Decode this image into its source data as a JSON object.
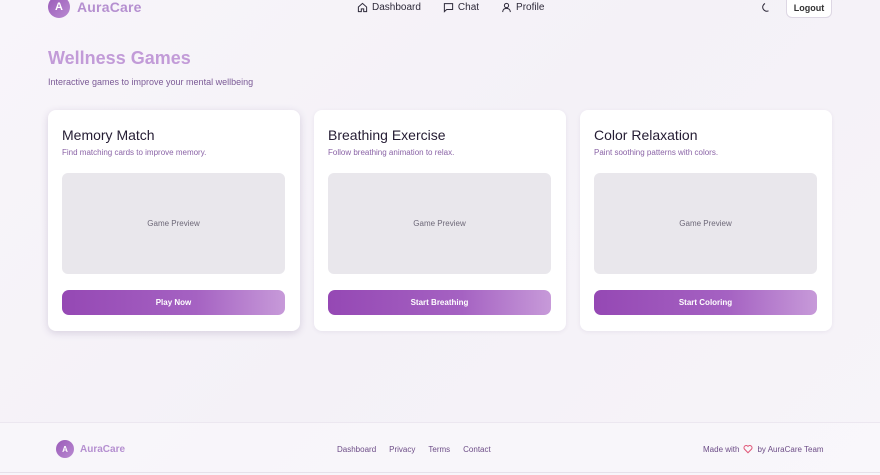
{
  "brand": {
    "logo_letter": "A",
    "name": "AuraCare"
  },
  "nav": {
    "items": [
      {
        "label": "Dashboard",
        "icon": "home-icon"
      },
      {
        "label": "Chat",
        "icon": "chat-icon"
      },
      {
        "label": "Profile",
        "icon": "user-icon"
      }
    ],
    "theme_icon": "moon-icon",
    "logout_label": "Logout"
  },
  "page": {
    "title": "Wellness Games",
    "subtitle": "Interactive games to improve your mental wellbeing"
  },
  "games": [
    {
      "title": "Memory Match",
      "description": "Find matching cards to improve memory.",
      "preview": "Game Preview",
      "button": "Play Now"
    },
    {
      "title": "Breathing Exercise",
      "description": "Follow breathing animation to relax.",
      "preview": "Game Preview",
      "button": "Start Breathing"
    },
    {
      "title": "Color Relaxation",
      "description": "Paint soothing patterns with colors.",
      "preview": "Game Preview",
      "button": "Start Coloring"
    }
  ],
  "footer": {
    "logo_letter": "A",
    "name": "AuraCare",
    "links": [
      "Dashboard",
      "Privacy",
      "Terms",
      "Contact"
    ],
    "made_with_prefix": "Made with",
    "made_with_icon": "heart-icon",
    "made_with_suffix": "by AuraCare Team"
  },
  "colors": {
    "accent": "#9548b4",
    "accent_light": "#c29bd8",
    "heart": "#e05a7a"
  }
}
